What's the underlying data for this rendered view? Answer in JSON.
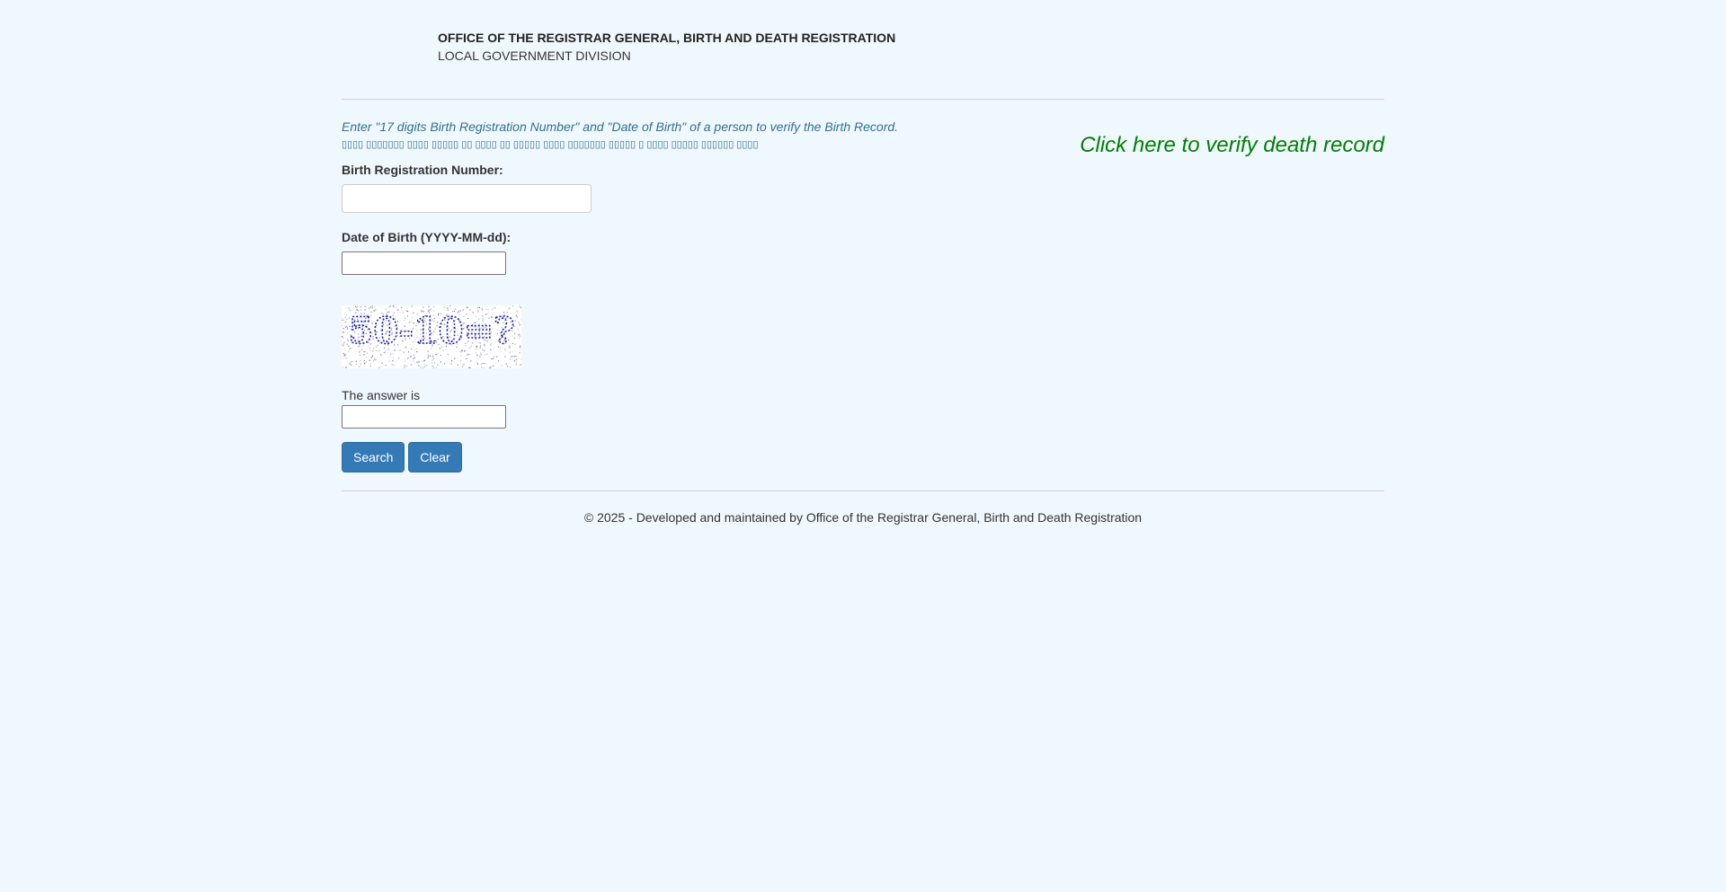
{
  "header": {
    "title": "OFFICE OF THE REGISTRAR GENERAL, BIRTH AND DEATH REGISTRATION",
    "subtitle": "LOCAL GOVERNMENT DIVISION"
  },
  "instructions": {
    "english": "Enter \"17 digits Birth Registration Number\" and \"Date of Birth\" of a person to verify the Birth Record.",
    "bengali": "▯▯▯▯ ▯▯▯▯▯▯▯ ▯▯▯▯ ▯▯▯▯▯ ▯▯ ▯▯▯▯ ▯▯ ▯▯▯▯▯ ▯▯▯▯ ▯▯▯▯▯▯▯ ▯▯▯▯▯ ▯ ▯▯▯▯ ▯▯▯▯▯ ▯▯▯▯▯▯ ▯▯▯▯"
  },
  "death_link": {
    "label": "Click here to verify death record"
  },
  "form": {
    "brn_label": "Birth Registration Number:",
    "brn_value": "",
    "dob_label": "Date of Birth (YYYY-MM-dd):",
    "dob_value": "",
    "captcha_text": "50-10=?",
    "answer_label": "The answer is",
    "answer_value": ""
  },
  "buttons": {
    "search": "Search",
    "clear": "Clear"
  },
  "footer": {
    "text": "© 2025 - Developed and maintained by Office of the Registrar General, Birth and Death Registration"
  },
  "colors": {
    "background": "#f0f8ff",
    "instruction_text": "#31708f",
    "death_link": "#008000",
    "button_primary": "#337ab7",
    "captcha_text": "#1a1aa6"
  }
}
